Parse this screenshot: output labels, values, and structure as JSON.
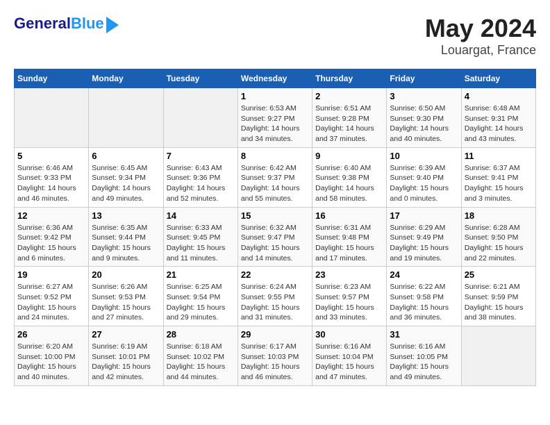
{
  "header": {
    "logo_line1": "General",
    "logo_line2": "Blue",
    "title": "May 2024",
    "subtitle": "Louargat, France"
  },
  "weekdays": [
    "Sunday",
    "Monday",
    "Tuesday",
    "Wednesday",
    "Thursday",
    "Friday",
    "Saturday"
  ],
  "weeks": [
    [
      {
        "num": "",
        "info": ""
      },
      {
        "num": "",
        "info": ""
      },
      {
        "num": "",
        "info": ""
      },
      {
        "num": "1",
        "info": "Sunrise: 6:53 AM\nSunset: 9:27 PM\nDaylight: 14 hours and 34 minutes."
      },
      {
        "num": "2",
        "info": "Sunrise: 6:51 AM\nSunset: 9:28 PM\nDaylight: 14 hours and 37 minutes."
      },
      {
        "num": "3",
        "info": "Sunrise: 6:50 AM\nSunset: 9:30 PM\nDaylight: 14 hours and 40 minutes."
      },
      {
        "num": "4",
        "info": "Sunrise: 6:48 AM\nSunset: 9:31 PM\nDaylight: 14 hours and 43 minutes."
      }
    ],
    [
      {
        "num": "5",
        "info": "Sunrise: 6:46 AM\nSunset: 9:33 PM\nDaylight: 14 hours and 46 minutes."
      },
      {
        "num": "6",
        "info": "Sunrise: 6:45 AM\nSunset: 9:34 PM\nDaylight: 14 hours and 49 minutes."
      },
      {
        "num": "7",
        "info": "Sunrise: 6:43 AM\nSunset: 9:36 PM\nDaylight: 14 hours and 52 minutes."
      },
      {
        "num": "8",
        "info": "Sunrise: 6:42 AM\nSunset: 9:37 PM\nDaylight: 14 hours and 55 minutes."
      },
      {
        "num": "9",
        "info": "Sunrise: 6:40 AM\nSunset: 9:38 PM\nDaylight: 14 hours and 58 minutes."
      },
      {
        "num": "10",
        "info": "Sunrise: 6:39 AM\nSunset: 9:40 PM\nDaylight: 15 hours and 0 minutes."
      },
      {
        "num": "11",
        "info": "Sunrise: 6:37 AM\nSunset: 9:41 PM\nDaylight: 15 hours and 3 minutes."
      }
    ],
    [
      {
        "num": "12",
        "info": "Sunrise: 6:36 AM\nSunset: 9:42 PM\nDaylight: 15 hours and 6 minutes."
      },
      {
        "num": "13",
        "info": "Sunrise: 6:35 AM\nSunset: 9:44 PM\nDaylight: 15 hours and 9 minutes."
      },
      {
        "num": "14",
        "info": "Sunrise: 6:33 AM\nSunset: 9:45 PM\nDaylight: 15 hours and 11 minutes."
      },
      {
        "num": "15",
        "info": "Sunrise: 6:32 AM\nSunset: 9:47 PM\nDaylight: 15 hours and 14 minutes."
      },
      {
        "num": "16",
        "info": "Sunrise: 6:31 AM\nSunset: 9:48 PM\nDaylight: 15 hours and 17 minutes."
      },
      {
        "num": "17",
        "info": "Sunrise: 6:29 AM\nSunset: 9:49 PM\nDaylight: 15 hours and 19 minutes."
      },
      {
        "num": "18",
        "info": "Sunrise: 6:28 AM\nSunset: 9:50 PM\nDaylight: 15 hours and 22 minutes."
      }
    ],
    [
      {
        "num": "19",
        "info": "Sunrise: 6:27 AM\nSunset: 9:52 PM\nDaylight: 15 hours and 24 minutes."
      },
      {
        "num": "20",
        "info": "Sunrise: 6:26 AM\nSunset: 9:53 PM\nDaylight: 15 hours and 27 minutes."
      },
      {
        "num": "21",
        "info": "Sunrise: 6:25 AM\nSunset: 9:54 PM\nDaylight: 15 hours and 29 minutes."
      },
      {
        "num": "22",
        "info": "Sunrise: 6:24 AM\nSunset: 9:55 PM\nDaylight: 15 hours and 31 minutes."
      },
      {
        "num": "23",
        "info": "Sunrise: 6:23 AM\nSunset: 9:57 PM\nDaylight: 15 hours and 33 minutes."
      },
      {
        "num": "24",
        "info": "Sunrise: 6:22 AM\nSunset: 9:58 PM\nDaylight: 15 hours and 36 minutes."
      },
      {
        "num": "25",
        "info": "Sunrise: 6:21 AM\nSunset: 9:59 PM\nDaylight: 15 hours and 38 minutes."
      }
    ],
    [
      {
        "num": "26",
        "info": "Sunrise: 6:20 AM\nSunset: 10:00 PM\nDaylight: 15 hours and 40 minutes."
      },
      {
        "num": "27",
        "info": "Sunrise: 6:19 AM\nSunset: 10:01 PM\nDaylight: 15 hours and 42 minutes."
      },
      {
        "num": "28",
        "info": "Sunrise: 6:18 AM\nSunset: 10:02 PM\nDaylight: 15 hours and 44 minutes."
      },
      {
        "num": "29",
        "info": "Sunrise: 6:17 AM\nSunset: 10:03 PM\nDaylight: 15 hours and 46 minutes."
      },
      {
        "num": "30",
        "info": "Sunrise: 6:16 AM\nSunset: 10:04 PM\nDaylight: 15 hours and 47 minutes."
      },
      {
        "num": "31",
        "info": "Sunrise: 6:16 AM\nSunset: 10:05 PM\nDaylight: 15 hours and 49 minutes."
      },
      {
        "num": "",
        "info": ""
      }
    ]
  ]
}
